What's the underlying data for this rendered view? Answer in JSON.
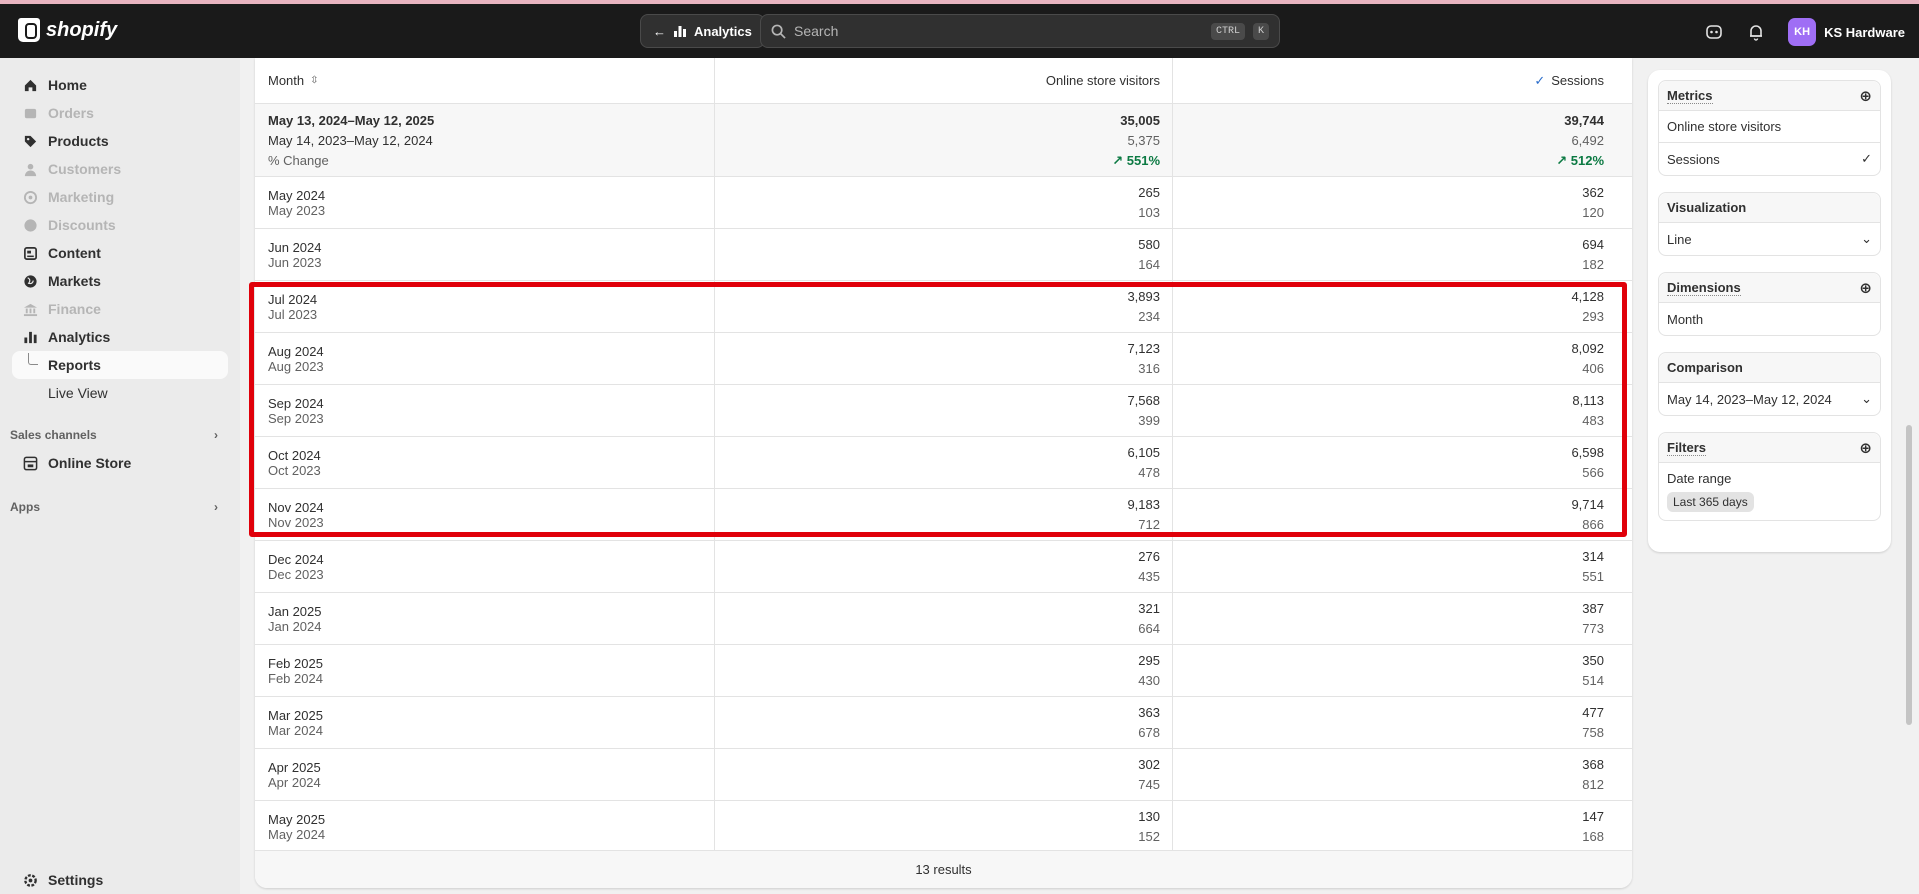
{
  "topbar": {
    "logo_text": "shopify",
    "back_label": "Analytics",
    "search_placeholder": "Search",
    "shortcut_key1": "CTRL",
    "shortcut_key2": "K",
    "avatar_initials": "KH",
    "store_name": "KS Hardware"
  },
  "sidebar": {
    "items": [
      {
        "label": "Home",
        "icon": "home-icon",
        "disabled": false
      },
      {
        "label": "Orders",
        "icon": "orders-icon",
        "disabled": true
      },
      {
        "label": "Products",
        "icon": "tag-icon",
        "disabled": false
      },
      {
        "label": "Customers",
        "icon": "person-icon",
        "disabled": true
      },
      {
        "label": "Marketing",
        "icon": "target-icon",
        "disabled": true
      },
      {
        "label": "Discounts",
        "icon": "discount-icon",
        "disabled": true
      },
      {
        "label": "Content",
        "icon": "content-icon",
        "disabled": false
      },
      {
        "label": "Markets",
        "icon": "globe-icon",
        "disabled": false
      },
      {
        "label": "Finance",
        "icon": "bank-icon",
        "disabled": true
      },
      {
        "label": "Analytics",
        "icon": "chart-icon",
        "disabled": false
      }
    ],
    "reports_label": "Reports",
    "liveview_label": "Live View",
    "sales_channels_label": "Sales channels",
    "online_store_label": "Online Store",
    "apps_label": "Apps",
    "settings_label": "Settings"
  },
  "table": {
    "col_month": "Month",
    "col_visitors": "Online store visitors",
    "col_sessions": "Sessions",
    "summary": {
      "period": "May 13, 2024–May 12, 2025",
      "compare_period": "May 14, 2023–May 12, 2024",
      "change_label": "% Change",
      "visitors": "35,005",
      "visitors_prev": "5,375",
      "visitors_change": "551%",
      "sessions": "39,744",
      "sessions_prev": "6,492",
      "sessions_change": "512%"
    },
    "rows": [
      {
        "month": "May 2024",
        "prev": "May 2023",
        "v": "265",
        "vp": "103",
        "s": "362",
        "sp": "120"
      },
      {
        "month": "Jun 2024",
        "prev": "Jun 2023",
        "v": "580",
        "vp": "164",
        "s": "694",
        "sp": "182"
      },
      {
        "month": "Jul 2024",
        "prev": "Jul 2023",
        "v": "3,893",
        "vp": "234",
        "s": "4,128",
        "sp": "293"
      },
      {
        "month": "Aug 2024",
        "prev": "Aug 2023",
        "v": "7,123",
        "vp": "316",
        "s": "8,092",
        "sp": "406"
      },
      {
        "month": "Sep 2024",
        "prev": "Sep 2023",
        "v": "7,568",
        "vp": "399",
        "s": "8,113",
        "sp": "483"
      },
      {
        "month": "Oct 2024",
        "prev": "Oct 2023",
        "v": "6,105",
        "vp": "478",
        "s": "6,598",
        "sp": "566"
      },
      {
        "month": "Nov 2024",
        "prev": "Nov 2023",
        "v": "9,183",
        "vp": "712",
        "s": "9,714",
        "sp": "866"
      },
      {
        "month": "Dec 2024",
        "prev": "Dec 2023",
        "v": "276",
        "vp": "435",
        "s": "314",
        "sp": "551"
      },
      {
        "month": "Jan 2025",
        "prev": "Jan 2024",
        "v": "321",
        "vp": "664",
        "s": "387",
        "sp": "773"
      },
      {
        "month": "Feb 2025",
        "prev": "Feb 2024",
        "v": "295",
        "vp": "430",
        "s": "350",
        "sp": "514"
      },
      {
        "month": "Mar 2025",
        "prev": "Mar 2024",
        "v": "363",
        "vp": "678",
        "s": "477",
        "sp": "758"
      },
      {
        "month": "Apr 2025",
        "prev": "Apr 2024",
        "v": "302",
        "vp": "745",
        "s": "368",
        "sp": "812"
      },
      {
        "month": "May 2025",
        "prev": "May 2024",
        "v": "130",
        "vp": "152",
        "s": "147",
        "sp": "168"
      }
    ],
    "results_label": "13 results"
  },
  "panel": {
    "metrics_title": "Metrics",
    "metric_1": "Online store visitors",
    "metric_2": "Sessions",
    "visualization_title": "Visualization",
    "visualization_value": "Line",
    "dimensions_title": "Dimensions",
    "dimension_1": "Month",
    "comparison_title": "Comparison",
    "comparison_value": "May 14, 2023–May 12, 2024",
    "filters_title": "Filters",
    "filter_label": "Date range",
    "filter_chip": "Last 365 days"
  },
  "colors": {
    "accent_green": "#0c7a43",
    "highlight_red": "#e0000a",
    "topbar_bg": "#1a1a1a"
  }
}
